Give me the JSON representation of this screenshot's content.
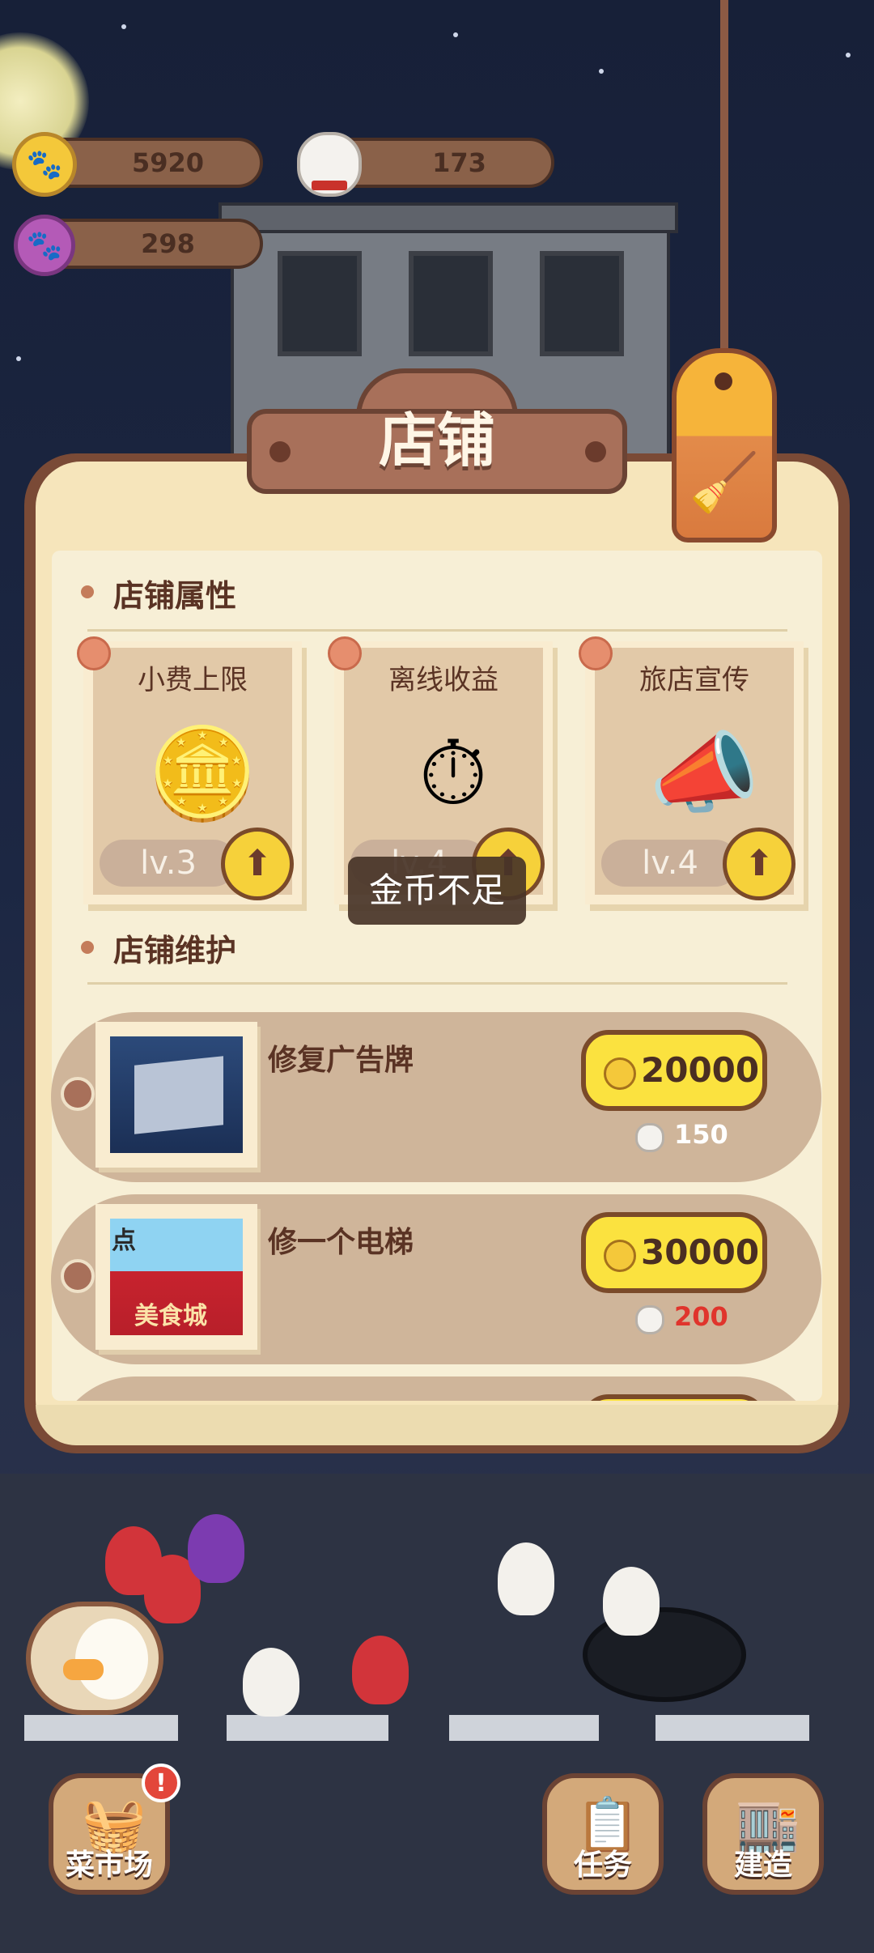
{
  "resources": {
    "coins": "5920",
    "chef_tokens": "173",
    "paw_gems": "298"
  },
  "panel": {
    "title": "店铺",
    "clean_tag_icon": "broom-icon"
  },
  "attributes_section": {
    "heading": "店铺属性",
    "cards": [
      {
        "title": "小费上限",
        "level": "lv.3",
        "icon": "gold-coins-icon"
      },
      {
        "title": "离线收益",
        "level": "lv.4",
        "icon": "pocket-watch-icon"
      },
      {
        "title": "旅店宣传",
        "level": "lv.4",
        "icon": "megaphone-icon"
      }
    ]
  },
  "toast": "金币不足",
  "maintenance_section": {
    "heading": "店铺维护",
    "items": [
      {
        "name": "修复广告牌",
        "price": "20000",
        "chef_cost": "150",
        "chef_cost_color": "#ffffff"
      },
      {
        "name": "修一个电梯",
        "price": "30000",
        "chef_cost": "200",
        "chef_cost_color": "#e0342c"
      }
    ],
    "thumb_sign_text": "美食城",
    "thumb_corner_text": "点"
  },
  "bottom_nav": {
    "market": "菜市场",
    "market_badge": "!",
    "tasks": "任务",
    "build": "建造"
  },
  "colors": {
    "panel_border": "#7a4a36",
    "panel_bg": "#f6e5bb",
    "button_yellow": "#fbe23f",
    "insufficient_red": "#e0342c"
  }
}
